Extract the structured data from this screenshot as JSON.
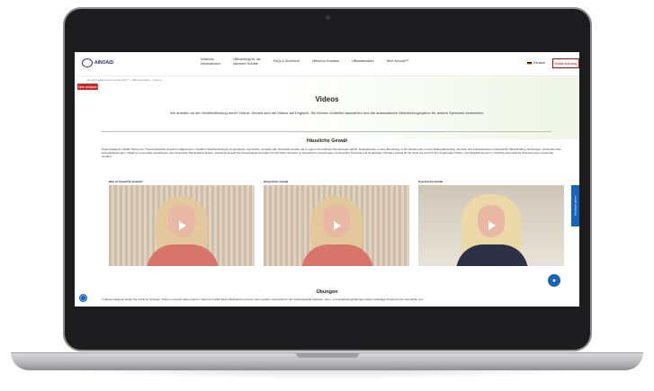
{
  "header": {
    "logo_text": "AINOAID",
    "nav": [
      {
        "line1": "Nützliche",
        "line2": "Informationen"
      },
      {
        "line1": "Hilfestellung für die",
        "line2": "nächsten Schritte"
      },
      {
        "line1": "FAQs & Sicherheit",
        "line2": ""
      },
      {
        "line1": "Hilfreiche Kontakte",
        "line2": ""
      },
      {
        "line1": "Hilfsmaterialien",
        "line2": ""
      },
      {
        "line1": "Über AinoAid™",
        "line2": ""
      }
    ],
    "language": "Deutsch",
    "emergency_label": "Notfall-Anleitung"
  },
  "breadcrumb": "Herzlich willkommen bei AinoAid™ > Hilfsmaterialien > Videos",
  "leave_button": "Seite verlassen",
  "page": {
    "title": "Videos",
    "subtitle": "Wir arbeiten an der Veröffentlichung neuer Videos. Derzeit sind die Videos auf Englisch. Sie können Untertitel auswählen und die automatische Übersetzungsoption für andere Sprachen verwenden."
  },
  "section1": {
    "title": "Häusliche Gewalt",
    "text": "Diese Kategorie enthält Videos zum Thema häusliche Gewalt im Allgemeinen. Gewalt in Paarbeziehungen ist physische, psychische, sexuelle oder finanzielle Gewalt, die in engen menschlichen Beziehungen auftritt, beispielsweise in einer Beziehung, in der Familie oder in einer Dating-Beziehung. Sie kann sich beispielsweise in körperlicher Misshandlung, Drohungen, Versuchen oder Kontrollhandlungen, Nötigung zu sexuellen Handlungen oder finanzieller Manipulation äußern. Häusliche Gewalt hat schwerwiegende Folgen für die Opfer und kann zu körperlichen Verletzungen, psychischen Traumata und langfristigen Schäden sowohl für die Opfer als auch für ihre Angehörigen führen. (Auf Englisch können in YouTube automatische Übersetzungen verwendet werden)"
  },
  "videos": [
    {
      "label": "Was ist häusliche Gewalt?"
    },
    {
      "label": "Körperliche Gewalt"
    },
    {
      "label": "Psychische Gewalt"
    }
  ],
  "feedback_label": "Feedback geben",
  "section2": {
    "title": "Übungen",
    "text": "In dieser Kategorie finden Sie nützliche Übungen: Körper und Geist gehen Hand in Hand und selbst kleine Maßnahmen können einen großen Unterschied in der Lebensqualität bewirken. Atem- und Verarbeitungsübungen bieten vielseitige Vorteile für die körperliche und"
  }
}
